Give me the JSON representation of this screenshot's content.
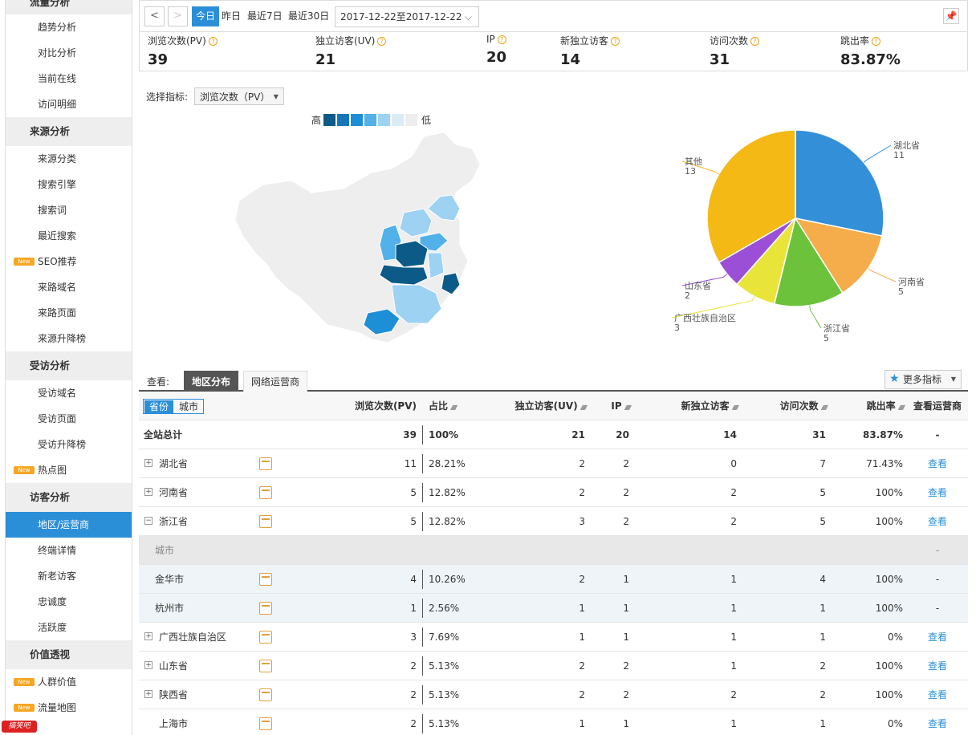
{
  "sidebar": {
    "top_partial": "流量分析",
    "sections": [
      {
        "items": [
          "趋势分析",
          "对比分析",
          "当前在线",
          "访问明细"
        ]
      },
      {
        "title": "来源分析",
        "items": [
          "来源分类",
          "搜索引擎",
          "搜索词",
          "最近搜索",
          "SEO推荐",
          "来路域名",
          "来路页面",
          "来源升降榜"
        ]
      },
      {
        "title": "受访分析",
        "items": [
          "受访域名",
          "受访页面",
          "受访升降榜",
          "热点图"
        ]
      },
      {
        "title": "访客分析",
        "items": [
          "地区/运营商",
          "终端详情",
          "新老访客",
          "忠诚度",
          "活跃度"
        ]
      },
      {
        "title": "价值透视",
        "items": [
          "人群价值",
          "流量地图"
        ]
      }
    ],
    "new_tag": "New",
    "active_item": "地区/运营商"
  },
  "toolbar": {
    "prev": "<",
    "next": ">",
    "today": "今日",
    "yesterday": "昨日",
    "last7": "最近7日",
    "last30": "最近30日",
    "date_range": "2017-12-22至2017-12-22"
  },
  "summary": [
    {
      "label": "浏览次数(PV)",
      "value": "39"
    },
    {
      "label": "独立访客(UV)",
      "value": "21"
    },
    {
      "label": "IP",
      "value": "20"
    },
    {
      "label": "新独立访客",
      "value": "14"
    },
    {
      "label": "访问次数",
      "value": "31"
    },
    {
      "label": "跳出率",
      "value": "83.87%"
    }
  ],
  "metric": {
    "label": "选择指标:",
    "value": "浏览次数（PV）"
  },
  "legend": {
    "high": "高",
    "low": "低",
    "colors": [
      "#0b5a87",
      "#1577b8",
      "#1d8fd6",
      "#52b1e8",
      "#9dd2f2",
      "#d9ecf7",
      "#eeeeee"
    ]
  },
  "chart_data": {
    "type": "pie",
    "slices": [
      {
        "name": "湖北省",
        "value": 11,
        "color": "#3390d8"
      },
      {
        "name": "河南省",
        "value": 5,
        "color": "#f4ad4a"
      },
      {
        "name": "浙江省",
        "value": 5,
        "color": "#6cc23a"
      },
      {
        "name": "广西壮族自治区",
        "value": 3,
        "color": "#e8e43a"
      },
      {
        "name": "山东省",
        "value": 2,
        "color": "#9b4fd6"
      },
      {
        "name": "其他",
        "value": 13,
        "color": "#f4b915"
      }
    ]
  },
  "tabs": {
    "view": "查看:",
    "region": "地区分布",
    "isp": "网络运营商",
    "more": "更多指标"
  },
  "table": {
    "toggle_province": "省份",
    "toggle_city": "城市",
    "headers": [
      "浏览次数(PV)",
      "占比",
      "独立访客(UV)",
      "IP",
      "新独立访客",
      "访问次数",
      "跳出率",
      "查看运营商"
    ],
    "total": [
      "全站总计",
      "39",
      "100%",
      "21",
      "20",
      "14",
      "31",
      "83.87%",
      "-"
    ],
    "rows": [
      {
        "kind": "province",
        "exp": "+",
        "cells": [
          "湖北省",
          "11",
          "28.21%",
          "2",
          "2",
          "0",
          "7",
          "71.43%",
          "查看"
        ]
      },
      {
        "kind": "province",
        "exp": "+",
        "cells": [
          "河南省",
          "5",
          "12.82%",
          "2",
          "2",
          "2",
          "5",
          "100%",
          "查看"
        ]
      },
      {
        "kind": "province",
        "exp": "−",
        "cells": [
          "浙江省",
          "5",
          "12.82%",
          "3",
          "2",
          "2",
          "5",
          "100%",
          "查看"
        ]
      },
      {
        "kind": "city-label",
        "cells": [
          "城市",
          "",
          "",
          "",
          "",
          "",
          "",
          "",
          "-"
        ]
      },
      {
        "kind": "city",
        "cells": [
          "金华市",
          "4",
          "10.26%",
          "2",
          "1",
          "1",
          "4",
          "100%",
          "-"
        ]
      },
      {
        "kind": "city",
        "cells": [
          "杭州市",
          "1",
          "2.56%",
          "1",
          "1",
          "1",
          "1",
          "100%",
          "-"
        ]
      },
      {
        "kind": "province",
        "exp": "+",
        "cells": [
          "广西壮族自治区",
          "3",
          "7.69%",
          "1",
          "1",
          "1",
          "1",
          "0%",
          "查看"
        ]
      },
      {
        "kind": "province",
        "exp": "+",
        "cells": [
          "山东省",
          "2",
          "5.13%",
          "2",
          "2",
          "1",
          "2",
          "100%",
          "查看"
        ]
      },
      {
        "kind": "province",
        "exp": "+",
        "cells": [
          "陕西省",
          "2",
          "5.13%",
          "2",
          "2",
          "2",
          "2",
          "100%",
          "查看"
        ]
      },
      {
        "kind": "province",
        "cells": [
          "上海市",
          "2",
          "5.13%",
          "1",
          "1",
          "1",
          "1",
          "0%",
          "查看"
        ]
      }
    ]
  },
  "watermark": "搞笑吧"
}
